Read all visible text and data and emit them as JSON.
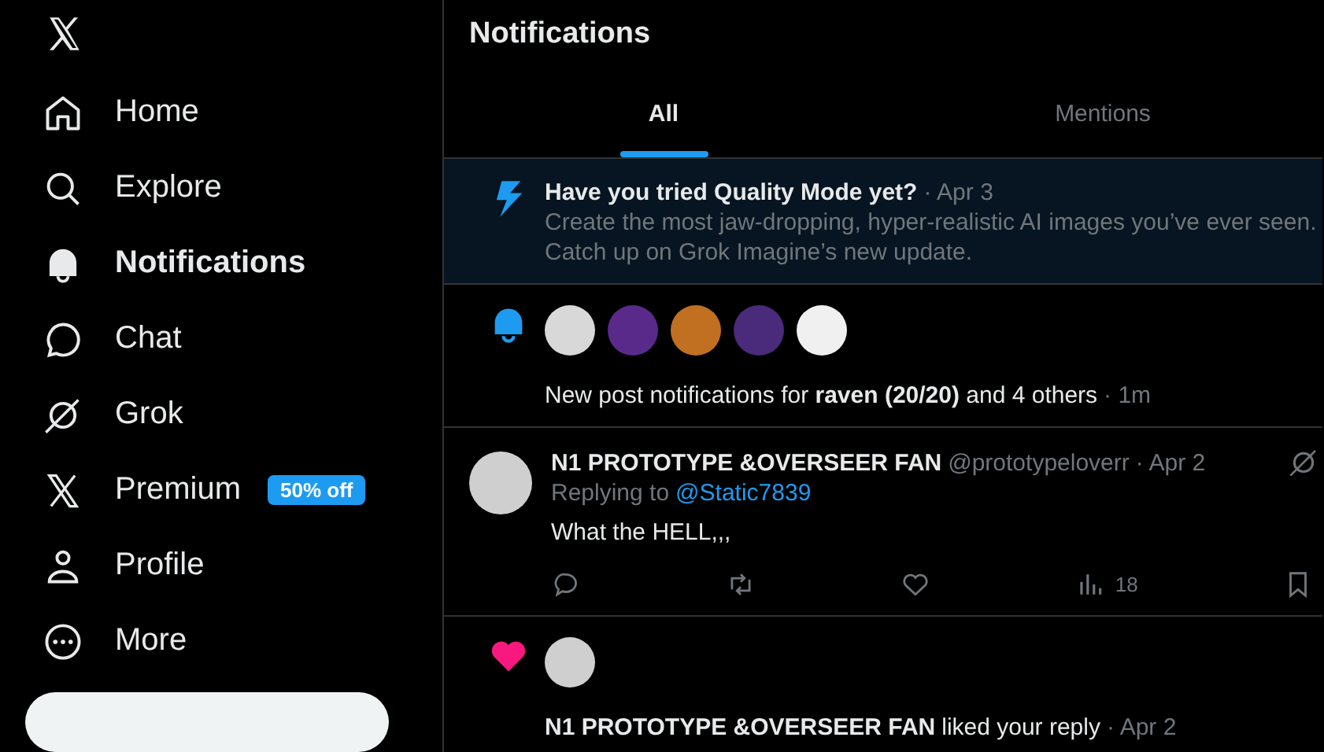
{
  "sidebar": {
    "items": [
      {
        "kind": "home",
        "label": "Home",
        "selected": false
      },
      {
        "kind": "search",
        "label": "Explore",
        "selected": false
      },
      {
        "kind": "bell",
        "label": "Notifications",
        "selected": true
      },
      {
        "kind": "chat",
        "label": "Chat",
        "selected": false
      },
      {
        "kind": "grok",
        "label": "Grok",
        "selected": false
      },
      {
        "kind": "x",
        "label": "Premium",
        "selected": false,
        "badge": "50% off"
      },
      {
        "kind": "person",
        "label": "Profile",
        "selected": false
      },
      {
        "kind": "more",
        "label": "More",
        "selected": false
      }
    ]
  },
  "header": {
    "title": "Notifications"
  },
  "tabs": [
    {
      "label": "All",
      "selected": true
    },
    {
      "label": "Mentions",
      "selected": false
    }
  ],
  "notifications": [
    {
      "kind": "promo",
      "unread": true,
      "title": "Have you tried Quality Mode yet?",
      "time": "· Apr 3",
      "lines": [
        "Create the most jaw-dropping, hyper-realistic AI images you’ve ever seen.",
        "Catch up on Grok Imagine’s new update."
      ]
    },
    {
      "kind": "bell",
      "unread": false,
      "avatars": [
        {
          "color": "#d8d8d8"
        },
        {
          "color": "#5a2a8a"
        },
        {
          "color": "#c07020"
        },
        {
          "color": "#4a2a7a"
        },
        {
          "color": "#f0f0f0"
        }
      ],
      "text": "New post notifications for **raven (20/20)** and 4 others",
      "time": "· 1m"
    },
    {
      "kind": "post",
      "unread": false,
      "avatar": {
        "color": "#cfcfcf"
      },
      "name": "N1 PROTOTYPE &OVERSEER FAN",
      "handle": "@prototypeloverr",
      "time": "· Apr 2",
      "replying_label": "Replying to",
      "replying_to": "@Static7839",
      "body": "What the HELL,,,",
      "views": "18"
    },
    {
      "kind": "like",
      "unread": false,
      "avatars": [
        {
          "color": "#cfcfcf"
        }
      ],
      "name": "N1 PROTOTYPE &OVERSEER FAN",
      "text": "liked your reply",
      "time": "· Apr 2"
    }
  ]
}
